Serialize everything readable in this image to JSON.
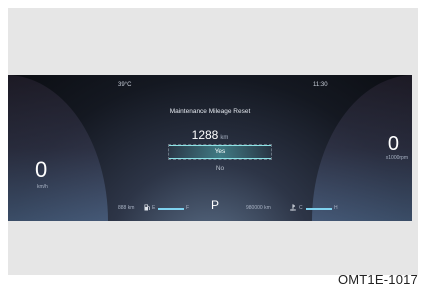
{
  "status_bar": {
    "temperature": "39°C",
    "time": "11:30"
  },
  "menu": {
    "title": "Maintenance Mileage Reset",
    "mileage_value": "1288",
    "mileage_unit": "km",
    "options": [
      "Yes",
      "No"
    ],
    "selected_option": "Yes"
  },
  "speedometer": {
    "value": "0",
    "unit": "km/h"
  },
  "tachometer": {
    "value": "0",
    "unit": "x1000rpm"
  },
  "bottom_bar": {
    "range_value": "888",
    "range_unit": "km",
    "fuel_empty_label": "E",
    "fuel_full_label": "F",
    "gear": "P",
    "odometer_value": "980000",
    "odometer_unit": "km",
    "temp_cold_label": "C",
    "temp_hot_label": "H"
  },
  "figure_code": "OMT1E-1017"
}
